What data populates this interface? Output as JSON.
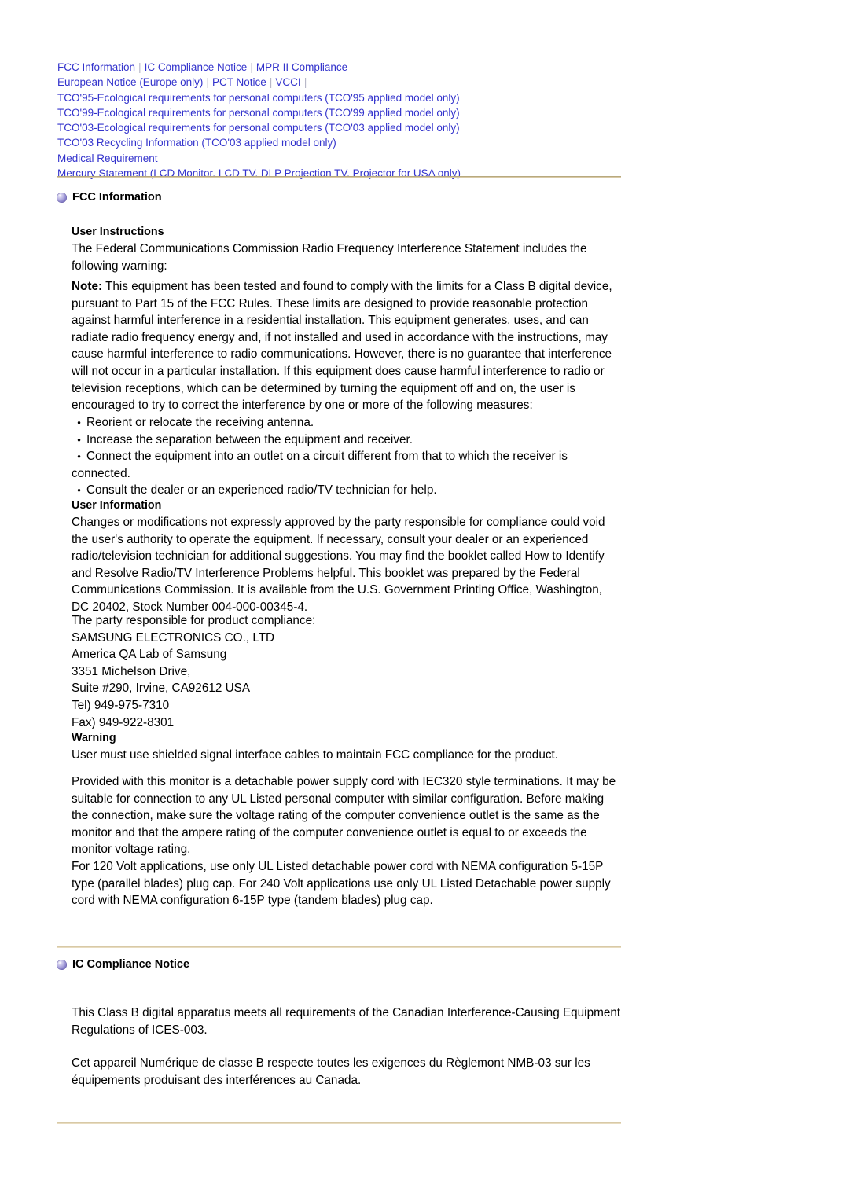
{
  "nav": {
    "separator": "|",
    "lines": [
      {
        "items": [
          {
            "label": "FCC Information"
          },
          {
            "label": "IC Compliance Notice"
          },
          {
            "label": "MPR II Compliance"
          }
        ],
        "trailing_separator": false
      },
      {
        "items": [
          {
            "label": "European Notice (Europe only)"
          },
          {
            "label": "PCT Notice"
          },
          {
            "label": "VCCI"
          }
        ],
        "trailing_separator": true
      }
    ],
    "single_links": [
      "TCO'95-Ecological requirements for personal computers (TCO'95 applied model only)",
      "TCO'99-Ecological requirements for personal computers (TCO'99 applied model only)",
      "TCO'03-Ecological requirements for personal computers (TCO'03 applied model only)",
      "TCO'03 Recycling Information (TCO'03 applied model only)",
      "Medical Requirement",
      "Mercury Statement (LCD Monitor, LCD TV, DLP Projection TV, Projector for USA only)"
    ],
    "link_color": "#3333CC",
    "separator_color": "#B8B8C8"
  },
  "rule_color": "#D8C9A6",
  "sections": {
    "fcc": {
      "heading": "FCC Information",
      "bullet_icon": "purple-orb-icon",
      "user_instructions": {
        "heading": "User Instructions",
        "intro": "The Federal Communications Commission Radio Frequency Interference Statement includes the following warning:",
        "note_label": "Note:",
        "note_body": " This equipment has been tested and found to comply with the limits for a Class B digital device, pursuant to Part 15 of the FCC Rules. These limits are designed to provide reasonable protection against harmful interference in a residential installation. This equipment generates, uses, and can radiate radio frequency energy and, if not installed and used in accordance with the instructions, may cause harmful interference to radio communications. However, there is no guarantee that interference will not occur in a particular installation. If this equipment does cause harmful interference to radio or television receptions, which can be determined by turning the equipment off and on, the user is encouraged to try to correct the interference by one or more of the following measures:",
        "measures": [
          "Reorient or relocate the receiving antenna.",
          "Increase the separation between the equipment and receiver.",
          "Connect the equipment into an outlet on a circuit different from that to which the receiver is connected.",
          "Consult the dealer or an experienced radio/TV technician for help."
        ],
        "bullet_glyph": "•"
      },
      "user_information": {
        "heading": "User Information",
        "body": "Changes or modifications not expressly approved by the party responsible for compliance could void the user's authority to operate the equipment. If necessary, consult your dealer or an experienced radio/television technician for additional suggestions. You may find the booklet called How to Identify and Resolve Radio/TV Interference Problems helpful. This booklet was prepared by the Federal Communications Commission. It is available from the U.S. Government Printing Office, Washington, DC 20402, Stock Number 004-000-00345-4.",
        "address": [
          "The party responsible for product compliance:",
          "SAMSUNG ELECTRONICS CO., LTD",
          "America QA Lab of Samsung",
          "3351 Michelson Drive,",
          "Suite #290, Irvine, CA92612 USA",
          "Tel) 949-975-7310",
          "Fax) 949-922-8301"
        ]
      },
      "warning": {
        "heading": "Warning",
        "line1": "User must use shielded signal interface cables to maintain FCC compliance for the product.",
        "para2": "Provided with this monitor is a detachable power supply cord with IEC320 style terminations. It may be suitable for connection to any UL Listed personal computer with similar configuration. Before making the connection, make sure the voltage rating of the computer convenience outlet is the same as the monitor and that the ampere rating of the computer convenience outlet is equal to or exceeds the monitor voltage rating.",
        "para3": "For 120 Volt applications, use only UL Listed detachable power cord with NEMA configuration 5-15P type (parallel blades) plug cap. For 240 Volt applications use only UL Listed Detachable power supply cord with NEMA configuration 6-15P type (tandem blades) plug cap."
      }
    },
    "ic": {
      "heading": "IC Compliance Notice",
      "bullet_icon": "purple-orb-icon",
      "para1": "This Class B digital apparatus meets all requirements of the Canadian Interference-Causing Equipment Regulations of ICES-003.",
      "para2": "Cet appareil Numérique de classe B respecte toutes les exigences du Règlemont NMB-03 sur les équipements produisant des interférences au Canada."
    }
  }
}
